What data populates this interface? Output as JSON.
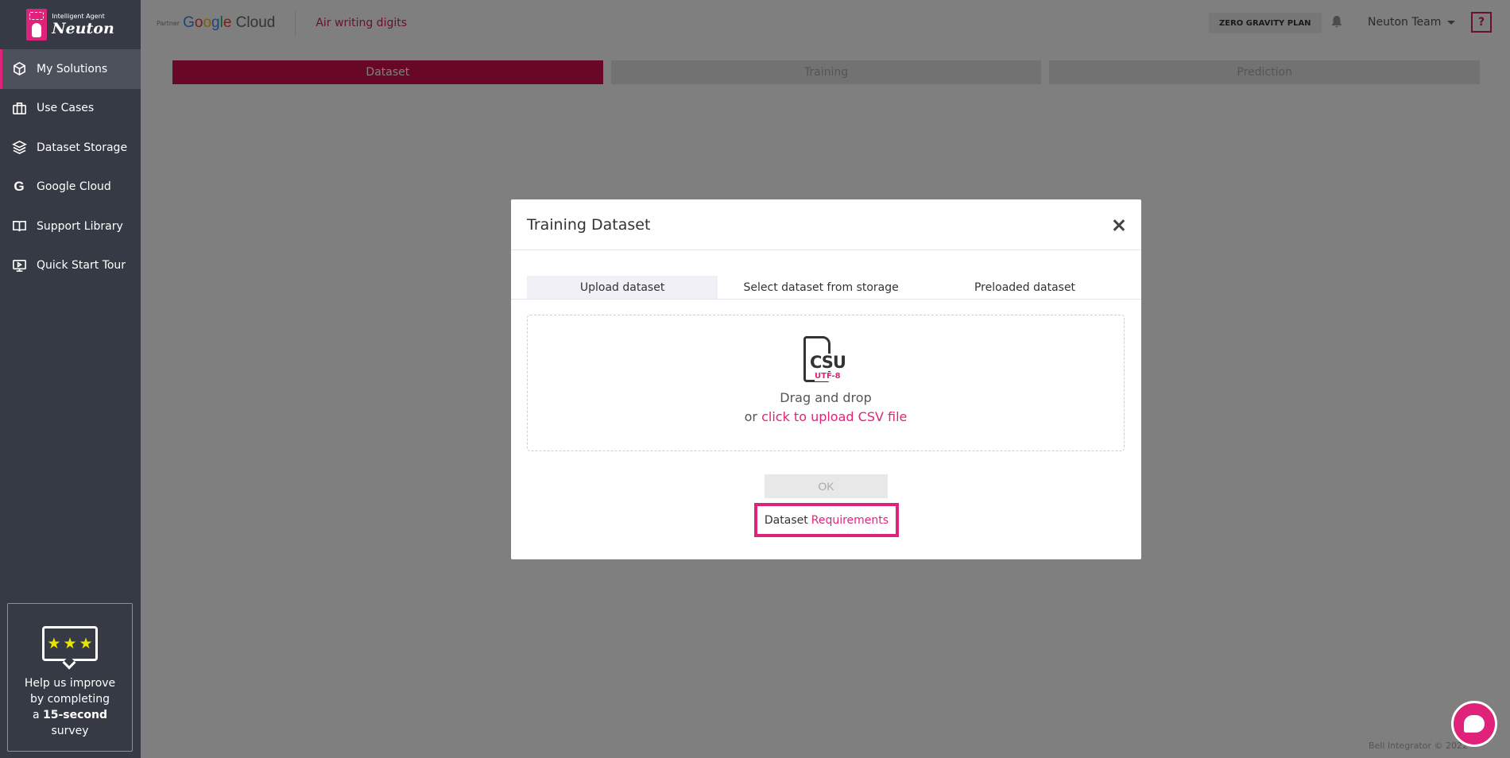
{
  "brand": {
    "logo_small": "Intelligent Agent",
    "logo_name": "Neuton",
    "accent_color": "#e0237a"
  },
  "sidebar": {
    "items": [
      {
        "label": "My Solutions",
        "icon": "cube-icon",
        "active": true
      },
      {
        "label": "Use Cases",
        "icon": "briefcase-icon",
        "active": false
      },
      {
        "label": "Dataset Storage",
        "icon": "layers-icon",
        "active": false
      },
      {
        "label": "Google Cloud",
        "icon": "google-g-icon",
        "active": false
      },
      {
        "label": "Support Library",
        "icon": "book-icon",
        "active": false
      },
      {
        "label": "Quick Start Tour",
        "icon": "play-screen-icon",
        "active": false
      }
    ],
    "survey": {
      "line1": "Help us improve",
      "line2": "by completing",
      "line3_prefix": "a",
      "line3_bold": "15-second",
      "line4": "survey"
    }
  },
  "header": {
    "partner_label": "Partner",
    "partner_name": "Google Cloud",
    "project_title": "Air writing digits",
    "plan": "ZERO GRAVITY PLAN",
    "user": "Neuton Team",
    "help": "?"
  },
  "steps": [
    {
      "label": "Dataset",
      "active": true
    },
    {
      "label": "Training",
      "active": false
    },
    {
      "label": "Prediction",
      "active": false
    }
  ],
  "modal": {
    "title": "Training Dataset",
    "tabs": [
      {
        "label": "Upload dataset",
        "active": true
      },
      {
        "label": "Select dataset from storage",
        "active": false
      },
      {
        "label": "Preloaded dataset",
        "active": false
      }
    ],
    "file_icon": {
      "format": "CSU",
      "encoding": "UTF-8"
    },
    "drop_text": "Drag and drop",
    "drop_or": "or",
    "upload_link": "click to upload CSV file",
    "ok_label": "OK",
    "req_prefix": "Dataset",
    "req_link": "Requirements"
  },
  "footer": {
    "copyright": "Bell Integrator © 2022"
  }
}
